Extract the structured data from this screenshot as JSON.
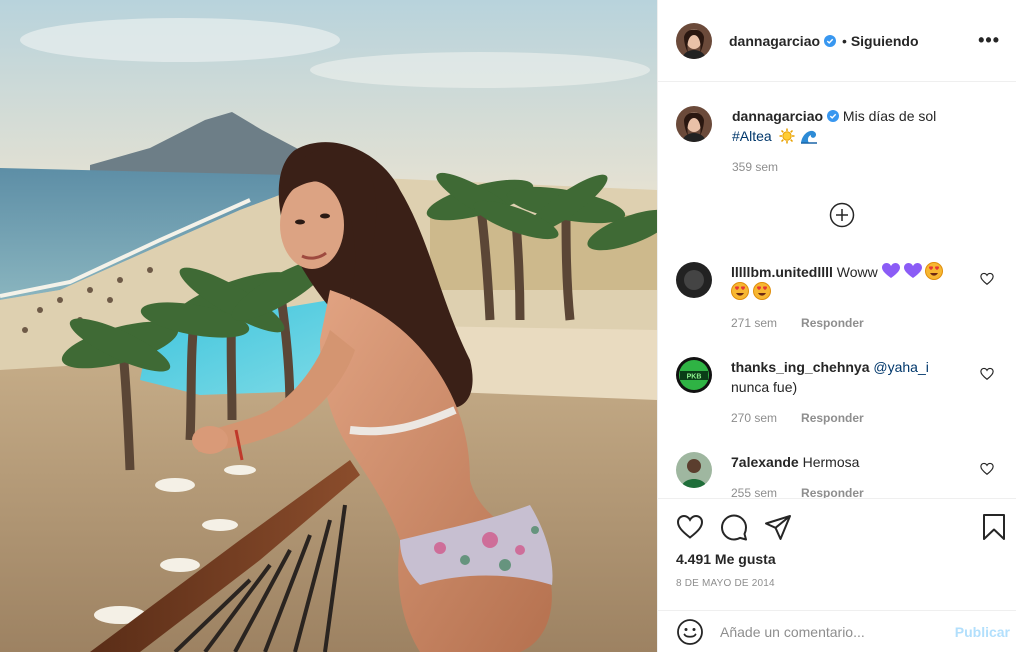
{
  "post": {
    "username": "dannagarciao",
    "follow_status": "Siguiendo",
    "more_icon": "more-options-icon",
    "caption": {
      "username": "dannagarciao",
      "text": "Mis días de sol",
      "hashtag": "#Altea",
      "emojis": [
        "sun-emoji",
        "wave-emoji"
      ],
      "age": "359 sem"
    },
    "load_more_icon": "plus-circle-icon",
    "comments": [
      {
        "username": "lllllbm.unitedllll",
        "text": "Woww",
        "emojis": [
          "purple-heart",
          "purple-heart",
          "heart-eyes",
          "heart-eyes",
          "heart-eyes"
        ],
        "age": "271 sem",
        "reply": "Responder"
      },
      {
        "username": "thanks_ing_chehnya",
        "mention": "@yaha_i",
        "text": "nunca fue)",
        "age": "270 sem",
        "reply": "Responder"
      },
      {
        "username": "7alexande",
        "text": "Hermosa",
        "age": "255 sem",
        "reply": "Responder"
      }
    ],
    "actions": [
      "heart-icon",
      "comment-icon",
      "share-icon",
      "bookmark-icon"
    ],
    "likes": "4.491 Me gusta",
    "date": "8 DE MAYO DE 2014",
    "comment_box": {
      "placeholder": "Añade un comentario...",
      "publish": "Publicar"
    }
  },
  "colors": {
    "text": "#262626",
    "muted": "#8e8e8e",
    "link": "#00376b",
    "verified": "#3897f0",
    "publish_disabled": "#b2dffc",
    "border": "#efefef"
  }
}
